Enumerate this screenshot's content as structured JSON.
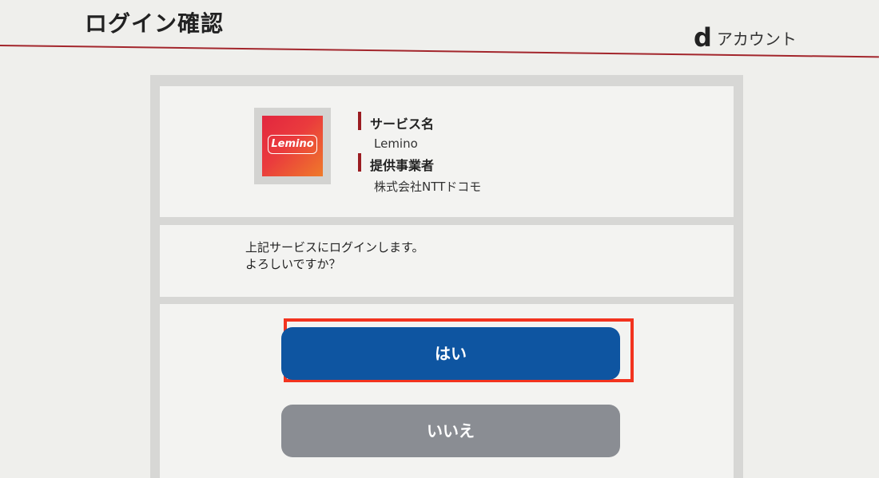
{
  "header": {
    "title": "ログイン確認",
    "brand_mark": "d",
    "brand_text": "アカウント",
    "accent_color": "#a3262c"
  },
  "service": {
    "logo_text": "Lemino",
    "name_label": "サービス名",
    "name_value": "Lemino",
    "provider_label": "提供事業者",
    "provider_value": "株式会社NTTドコモ"
  },
  "message": {
    "line1": "上記サービスにログインします。",
    "line2": "よろしいですか？"
  },
  "actions": {
    "yes_label": "はい",
    "no_label": "いいえ",
    "yes_color": "#0e55a1",
    "no_color": "#8a8d93",
    "highlight_color": "#f2331f"
  }
}
